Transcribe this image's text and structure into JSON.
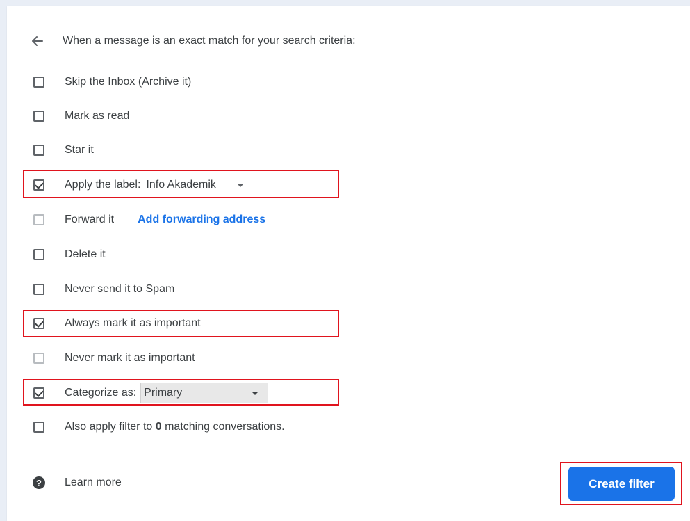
{
  "header": {
    "text": "When a message is an exact match for your search criteria:"
  },
  "options": [
    {
      "label": "Skip the Inbox (Archive it)",
      "checked": false
    },
    {
      "label": "Mark as read",
      "checked": false
    },
    {
      "label": "Star it",
      "checked": false
    },
    {
      "label": "Apply the label:",
      "checked": true,
      "selected": "Info Akademik"
    },
    {
      "label": "Forward it",
      "checked": false,
      "link": "Add forwarding address"
    },
    {
      "label": "Delete it",
      "checked": false
    },
    {
      "label": "Never send it to Spam",
      "checked": false
    },
    {
      "label": "Always mark it as important",
      "checked": true
    },
    {
      "label": "Never mark it as important",
      "checked": false
    },
    {
      "label": "Categorize as:",
      "checked": true,
      "selected": "Primary"
    },
    {
      "label_prefix": "Also apply filter to ",
      "count": "0",
      "label_suffix": " matching conversations.",
      "checked": false
    }
  ],
  "footer": {
    "learn_more": "Learn more",
    "create_filter": "Create filter"
  },
  "colors": {
    "accent": "#1a73e8",
    "highlight": "#e0141e"
  }
}
